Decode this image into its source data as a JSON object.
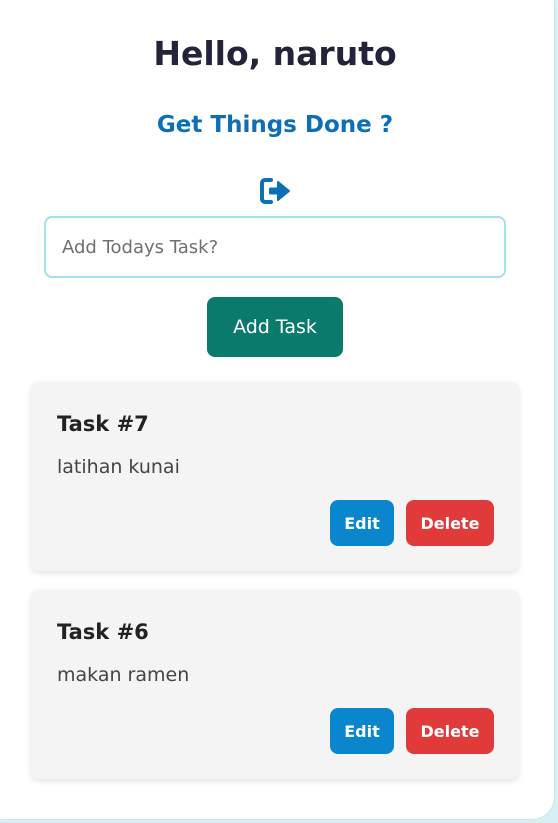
{
  "header": {
    "greeting": "Hello, naruto",
    "subtitle": "Get Things Done ?",
    "logout_icon": "sign-out-icon"
  },
  "form": {
    "placeholder": "Add Todays Task?",
    "value": "",
    "add_label": "Add Task"
  },
  "tasks": [
    {
      "title": "Task #7",
      "description": "latihan kunai",
      "edit_label": "Edit",
      "delete_label": "Delete"
    },
    {
      "title": "Task #6",
      "description": "makan ramen",
      "edit_label": "Edit",
      "delete_label": "Delete"
    }
  ],
  "colors": {
    "title": "#23233a",
    "subtitle": "#0d6fb8",
    "add_button": "#0a7a6c",
    "edit_button": "#0a86cf",
    "delete_button": "#e03a3a",
    "card": "#f4f4f4",
    "background": "#d6f0f5"
  }
}
